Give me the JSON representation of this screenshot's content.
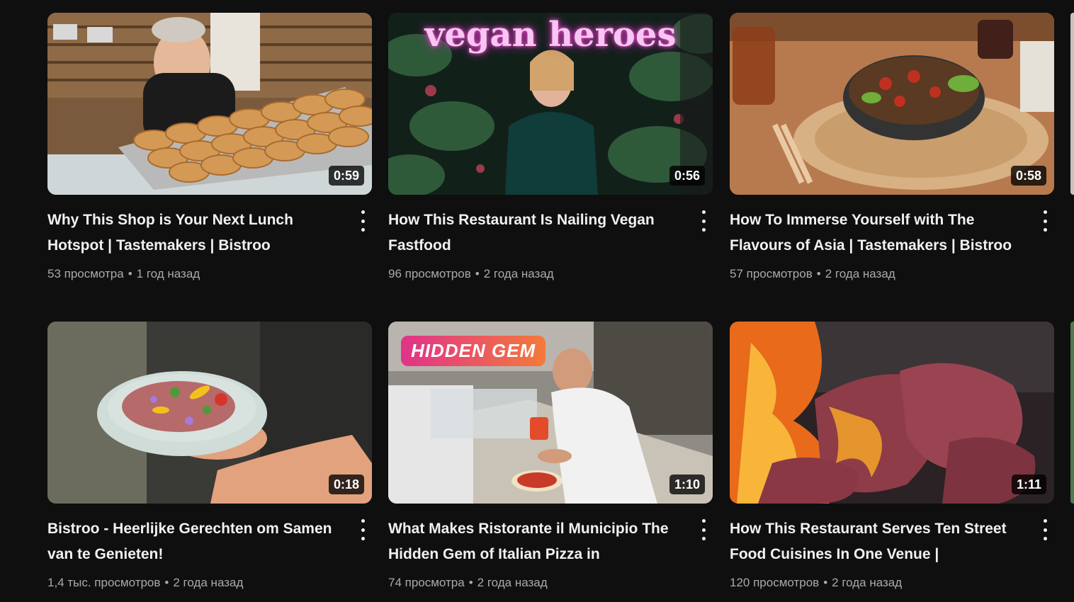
{
  "videos": [
    {
      "title": "Why This Shop is Your Next Lunch Hotspot | Tastemakers | Bistroo",
      "duration": "0:59",
      "views": "53 просмотра",
      "age": "1 год назад",
      "thumbnail_icon": "bakery-bread-rolls-thumbnail"
    },
    {
      "title": "How This Restaurant Is Nailing Vegan Fastfood",
      "duration": "0:56",
      "views": "96 просмотров",
      "age": "2 года назад",
      "thumbnail_icon": "vegan-heroes-presenter-thumbnail",
      "thumbnail_text": "vegan heroes"
    },
    {
      "title": "How To Immerse Yourself with The Flavours of Asia | Tastemakers | Bistroo",
      "duration": "0:58",
      "views": "57 просмотров",
      "age": "2 года назад",
      "thumbnail_icon": "asian-bowl-thumbnail"
    },
    {
      "title": "Bistroo - Heerlijke Gerechten om Samen van te Genieten!",
      "duration": "0:18",
      "views": "1,4 тыс. просмотров",
      "age": "2 года назад",
      "thumbnail_icon": "plated-dish-thumbnail"
    },
    {
      "title": "What Makes Ristorante il Municipio The Hidden Gem of Italian Pizza in Denekamp?",
      "duration": "1:10",
      "views": "74 просмотра",
      "age": "2 года назад",
      "thumbnail_icon": "pizza-chef-thumbnail",
      "thumbnail_text": "HIDDEN GEM"
    },
    {
      "title": "How This Restaurant Serves Ten Street Food Cuisines In One Venue | Tastemakers |...",
      "duration": "1:11",
      "views": "120 просмотров",
      "age": "2 года назад",
      "thumbnail_icon": "grilled-meat-thumbnail"
    }
  ],
  "separator": "•",
  "colors": {
    "background": "#0f0f0f",
    "title": "#f1f1f1",
    "meta": "#aaaaaa",
    "duration_bg": "#000000"
  }
}
